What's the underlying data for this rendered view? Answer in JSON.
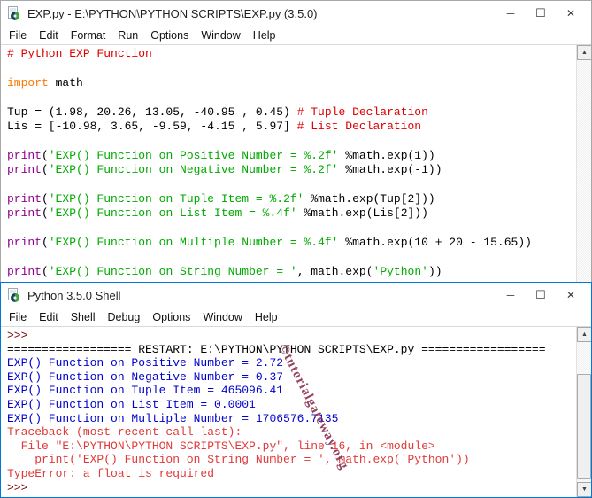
{
  "icons": {
    "up": "▲",
    "down": "▼"
  },
  "chrome": {
    "minimize": "─",
    "maximize": "☐",
    "close": "✕"
  },
  "colors": {
    "active_border": "#0078d7",
    "comment": "#dd0000",
    "keyword": "#ff7700",
    "builtin": "#900090",
    "string": "#00aa00",
    "stdout": "#0000cc",
    "stderr": "#e03a3a",
    "console_prompt": "#770000"
  },
  "watermark": "©tutorialgateway.org",
  "editor": {
    "title": "EXP.py - E:\\PYTHON\\PYTHON SCRIPTS\\EXP.py (3.5.0)",
    "menu": [
      "File",
      "Edit",
      "Format",
      "Run",
      "Options",
      "Window",
      "Help"
    ],
    "code_lines": [
      [
        {
          "t": "com",
          "s": "# Python EXP Function"
        }
      ],
      [],
      [
        {
          "t": "kw",
          "s": "import"
        },
        {
          "t": "def",
          "s": " math"
        }
      ],
      [],
      [
        {
          "t": "def",
          "s": "Tup = (1.98, 20.26, 13.05, -40.95 , 0.45) "
        },
        {
          "t": "com",
          "s": "# Tuple Declaration"
        }
      ],
      [
        {
          "t": "def",
          "s": "Lis = [-10.98, 3.65, -9.59, -4.15 , 5.97] "
        },
        {
          "t": "com",
          "s": "# List Declaration"
        }
      ],
      [],
      [
        {
          "t": "bi",
          "s": "print"
        },
        {
          "t": "def",
          "s": "("
        },
        {
          "t": "str",
          "s": "'EXP() Function on Positive Number = %.2f'"
        },
        {
          "t": "def",
          "s": " %math.exp(1))"
        }
      ],
      [
        {
          "t": "bi",
          "s": "print"
        },
        {
          "t": "def",
          "s": "("
        },
        {
          "t": "str",
          "s": "'EXP() Function on Negative Number = %.2f'"
        },
        {
          "t": "def",
          "s": " %math.exp(-1))"
        }
      ],
      [],
      [
        {
          "t": "bi",
          "s": "print"
        },
        {
          "t": "def",
          "s": "("
        },
        {
          "t": "str",
          "s": "'EXP() Function on Tuple Item = %.2f'"
        },
        {
          "t": "def",
          "s": " %math.exp(Tup[2]))"
        }
      ],
      [
        {
          "t": "bi",
          "s": "print"
        },
        {
          "t": "def",
          "s": "("
        },
        {
          "t": "str",
          "s": "'EXP() Function on List Item = %.4f'"
        },
        {
          "t": "def",
          "s": " %math.exp(Lis[2]))"
        }
      ],
      [],
      [
        {
          "t": "bi",
          "s": "print"
        },
        {
          "t": "def",
          "s": "("
        },
        {
          "t": "str",
          "s": "'EXP() Function on Multiple Number = %.4f'"
        },
        {
          "t": "def",
          "s": " %math.exp(10 + 20 - 15.65))"
        }
      ],
      [],
      [
        {
          "t": "bi",
          "s": "print"
        },
        {
          "t": "def",
          "s": "("
        },
        {
          "t": "str",
          "s": "'EXP() Function on String Number = '"
        },
        {
          "t": "def",
          "s": ", math.exp("
        },
        {
          "t": "str",
          "s": "'Python'"
        },
        {
          "t": "def",
          "s": "))"
        }
      ]
    ]
  },
  "shell": {
    "title": "Python 3.5.0 Shell",
    "menu": [
      "File",
      "Edit",
      "Shell",
      "Debug",
      "Options",
      "Window",
      "Help"
    ],
    "output_lines": [
      {
        "t": "prompt",
        "s": ">>> "
      },
      {
        "t": "restart",
        "s": "================== RESTART: E:\\PYTHON\\PYTHON SCRIPTS\\EXP.py =================="
      },
      {
        "t": "stdout",
        "s": "EXP() Function on Positive Number = 2.72"
      },
      {
        "t": "stdout",
        "s": "EXP() Function on Negative Number = 0.37"
      },
      {
        "t": "stdout",
        "s": "EXP() Function on Tuple Item = 465096.41"
      },
      {
        "t": "stdout",
        "s": "EXP() Function on List Item = 0.0001"
      },
      {
        "t": "stdout",
        "s": "EXP() Function on Multiple Number = 1706576.7135"
      },
      {
        "t": "stderr",
        "s": "Traceback (most recent call last):"
      },
      {
        "t": "stderr",
        "s": "  File \"E:\\PYTHON\\PYTHON SCRIPTS\\EXP.py\", line 16, in <module>"
      },
      {
        "t": "stderr",
        "s": "    print('EXP() Function on String Number = ', math.exp('Python'))"
      },
      {
        "t": "stderr",
        "s": "TypeError: a float is required"
      },
      {
        "t": "prompt",
        "s": ">>>"
      }
    ]
  }
}
